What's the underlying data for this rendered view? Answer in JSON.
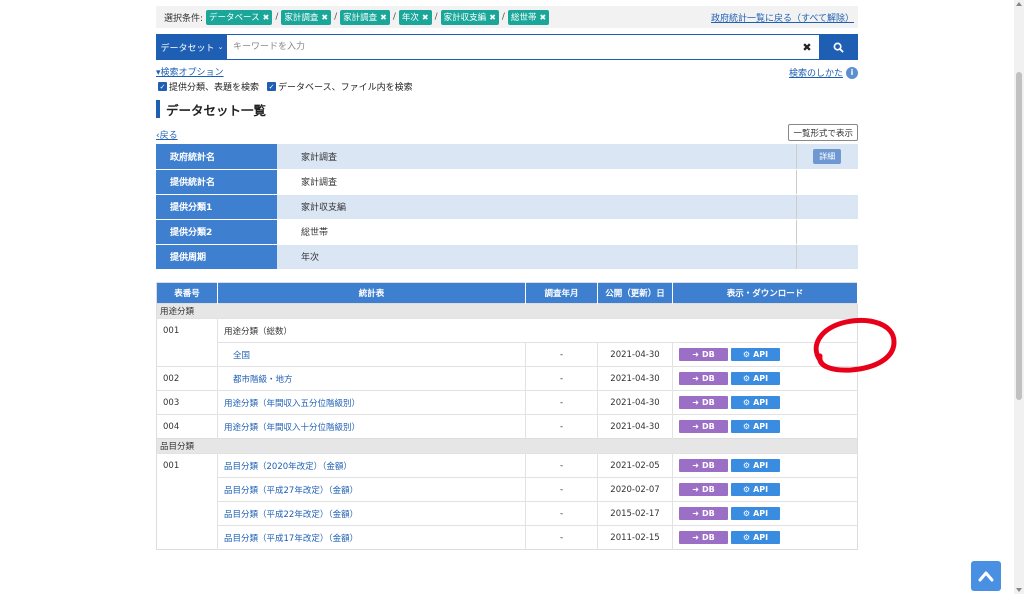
{
  "filters": {
    "label": "選択条件:",
    "chips": [
      "データベース",
      "家計調査",
      "家計調査",
      "年次",
      "家計収支編",
      "総世帯"
    ],
    "separator": "/",
    "reset_link": "政府統計一覧に戻る（すべて解除）"
  },
  "search": {
    "dataset_select": "データセット",
    "placeholder": "キーワードを入力",
    "options_link": "検索オプション",
    "how_to_link": "検索のしかた",
    "check1": "提供分類、表題を検索",
    "check2": "データベース、ファイル内を検索"
  },
  "section": {
    "title": "データセット一覧",
    "back_link": "戻る",
    "list_view_button": "一覧形式で表示"
  },
  "info": {
    "rows": [
      {
        "key": "政府統計名",
        "value": "家計調査"
      },
      {
        "key": "提供統計名",
        "value": "家計調査"
      },
      {
        "key": "提供分類1",
        "value": "家計収支編"
      },
      {
        "key": "提供分類2",
        "value": "総世帯"
      },
      {
        "key": "提供周期",
        "value": "年次"
      }
    ],
    "detail_button": "詳細"
  },
  "table": {
    "headers": [
      "表番号",
      "統計表",
      "調査年月",
      "公開（更新）日",
      "表示・ダウンロード"
    ],
    "groups": [
      {
        "label": "用途分類",
        "rows": [
          {
            "no": "001",
            "name": "用途分類（総数）",
            "ym": "",
            "pub": ""
          },
          {
            "no": "",
            "name": "全国",
            "ym": "-",
            "pub": "2021-04-30"
          },
          {
            "no": "002",
            "name": "都市階級・地方",
            "ym": "-",
            "pub": "2021-04-30"
          },
          {
            "no": "003",
            "name": "用途分類（年間収入五分位階級別）",
            "ym": "-",
            "pub": "2021-04-30"
          },
          {
            "no": "004",
            "name": "用途分類（年間収入十分位階級別）",
            "ym": "-",
            "pub": "2021-04-30"
          }
        ]
      },
      {
        "label": "品目分類",
        "rows": [
          {
            "no": "001",
            "name": "品目分類（2020年改定）（金額）",
            "ym": "-",
            "pub": "2021-02-05"
          },
          {
            "no": "",
            "name": "品目分類（平成27年改定）（金額）",
            "ym": "-",
            "pub": "2020-02-07"
          },
          {
            "no": "",
            "name": "品目分類（平成22年改定）（金額）",
            "ym": "-",
            "pub": "2015-02-17"
          },
          {
            "no": "",
            "name": "品目分類（平成17年改定）（金額）",
            "ym": "-",
            "pub": "2011-02-15"
          }
        ]
      }
    ],
    "db_label": "DB",
    "api_label": "API"
  },
  "colors": {
    "primary": "#1e5fb4",
    "chip": "#1aa79a",
    "db_button": "#9b6fc6",
    "api_button": "#3a8ce0",
    "annotation": "#e8001a"
  }
}
